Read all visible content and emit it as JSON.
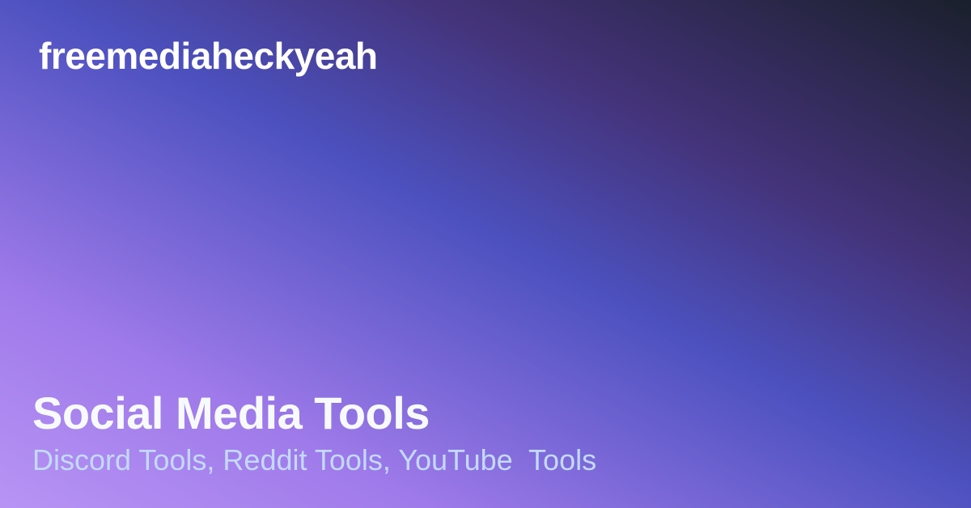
{
  "brand": "freemediaheckyeah",
  "title": "Social Media Tools",
  "subtitle": "Discord Tools, Reddit Tools, YouTube  Tools",
  "colors": {
    "gradient_start": "#b794f4",
    "gradient_mid": "#4c51bf",
    "gradient_end": "#1a202c",
    "title": "#f7fafc",
    "subtitle": "#c3dafe"
  }
}
